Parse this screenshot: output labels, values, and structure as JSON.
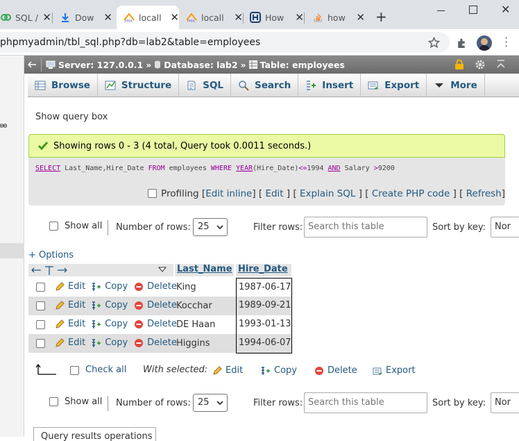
{
  "browser": {
    "tabs": [
      {
        "label": "SQL /",
        "icon": "sql-tab-icon"
      },
      {
        "label": "Dow",
        "icon": "download-tab-icon"
      },
      {
        "label": "locall",
        "icon": "phpmyadmin-tab-icon"
      },
      {
        "label": "locall",
        "icon": "phpmyadmin-tab-icon"
      },
      {
        "label": "How",
        "icon": "site-tab-icon"
      },
      {
        "label": "how",
        "icon": "stackoverflow-tab-icon"
      }
    ],
    "url": "phpmyadmin/tbl_sql.php?db=lab2&table=employees"
  },
  "breadcrumb": {
    "server": "Server: 127.0.0.1",
    "sep1": "»",
    "database": "Database: lab2",
    "sep2": "»",
    "table": "Table: employees"
  },
  "menu": {
    "items": [
      "Browse",
      "Structure",
      "SQL",
      "Search",
      "Insert",
      "Export",
      "More"
    ]
  },
  "query_box_link": "Show query box",
  "result": {
    "message": "Showing rows 0 - 3 (4 total, Query took 0.0011 seconds.)",
    "sql": {
      "t1": "SELECT",
      "t2": " Last_Name,Hire_Date ",
      "t3": "FROM",
      "t4": " employees ",
      "t5": "WHERE",
      "t6": " ",
      "t7": "YEAR",
      "t8": "(Hire_Date)",
      "t9": "<=",
      "t10": "1994 ",
      "t11": "AND",
      "t12": " Salary ",
      "t13": ">",
      "t14": "9200"
    },
    "profiling": {
      "label": "Profiling",
      "links": [
        "Edit inline",
        "Edit",
        "Explain SQL",
        "Create PHP code",
        "Refresh"
      ]
    }
  },
  "nav": {
    "show_all": "Show all",
    "rows_label": "Number of rows:",
    "rows_value": "25",
    "filter_label": "Filter rows:",
    "filter_placeholder": "Search this table",
    "sort_label": "Sort by key:",
    "sort_value": "Nor"
  },
  "options_link": "+ Options",
  "table": {
    "columns": [
      "Last_Name",
      "Hire_Date"
    ],
    "actions": {
      "edit": "Edit",
      "copy": "Copy",
      "delete": "Delete"
    },
    "rows": [
      {
        "last_name": "King",
        "hire_date": "1987-06-17"
      },
      {
        "last_name": "Kocchar",
        "hire_date": "1989-09-21"
      },
      {
        "last_name": "DE Haan",
        "hire_date": "1993-01-13"
      },
      {
        "last_name": "Higgins",
        "hire_date": "1994-06-07"
      }
    ]
  },
  "bulk": {
    "check_all": "Check all",
    "with_selected": "With selected:",
    "edit": "Edit",
    "copy": "Copy",
    "delete": "Delete",
    "export": "Export"
  },
  "bottom_tab": "Query results operations",
  "colors": {
    "link": "#235a81",
    "success_bg": "#ebf8a4",
    "keyword": "#990099"
  }
}
